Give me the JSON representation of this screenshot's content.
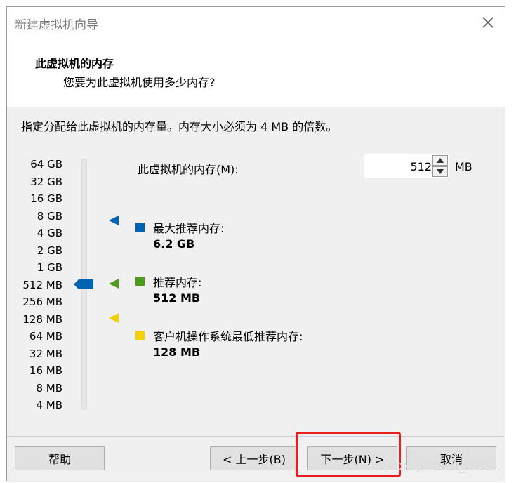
{
  "window": {
    "title": "新建虚拟机向导"
  },
  "header": {
    "title": "此虚拟机的内存",
    "subtitle": "您要为此虚拟机使用多少内存?"
  },
  "instruction": "指定分配给此虚拟机的内存量。内存大小必须为 4 MB 的倍数。",
  "slider": {
    "ticks": [
      "64 GB",
      "32 GB",
      "16 GB",
      "8 GB",
      "4 GB",
      "2 GB",
      "1 GB",
      "512 MB",
      "256 MB",
      "128 MB",
      "64 MB",
      "32 MB",
      "16 MB",
      "8 MB",
      "4 MB"
    ],
    "selected": "512 MB"
  },
  "memory": {
    "label": "此虚拟机的内存(M):",
    "value": "512",
    "unit": "MB"
  },
  "legend": [
    {
      "label": "最大推荐内存:",
      "value": "6.2 GB",
      "color": "#0063b1"
    },
    {
      "label": "推荐内存:",
      "value": "512 MB",
      "color": "#4e9a1e"
    },
    {
      "label": "客户机操作系统最低推荐内存:",
      "value": "128 MB",
      "color": "#f2cf00"
    }
  ],
  "buttons": {
    "help": "帮助",
    "back": "< 上一步(B)",
    "next": "下一步(N) >",
    "cancel": "取消"
  },
  "watermark": "CSDN @TODO_D2D",
  "colors": {
    "accent": "#0063b1",
    "highlight": "#e81d1d"
  },
  "icons": {
    "close": "close-icon",
    "spin_up": "chevron-up-icon",
    "spin_down": "chevron-down-icon"
  }
}
